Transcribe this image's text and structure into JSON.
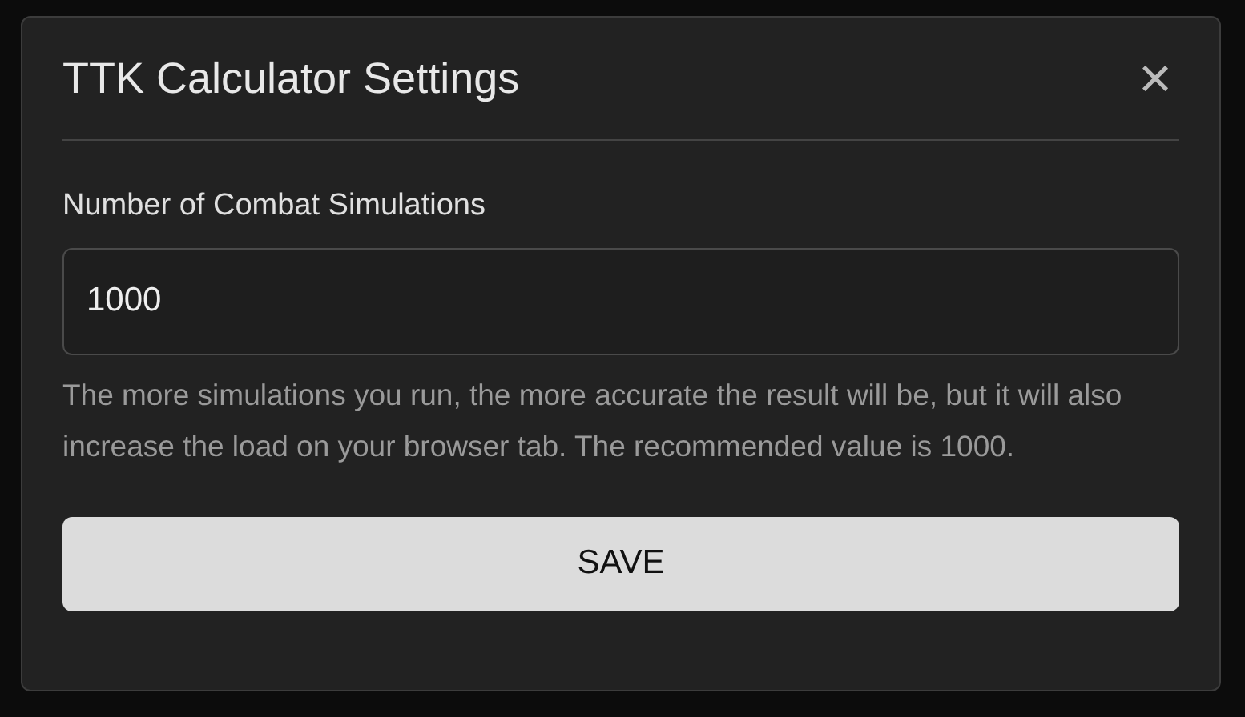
{
  "dialog": {
    "title": "TTK Calculator Settings",
    "close": "×",
    "field": {
      "label": "Number of Combat Simulations",
      "value": "1000"
    },
    "help": "The more simulations you run, the more accurate the result will be, but it will also increase the load on your browser tab. The recommended value is 1000.",
    "save": "SAVE"
  }
}
